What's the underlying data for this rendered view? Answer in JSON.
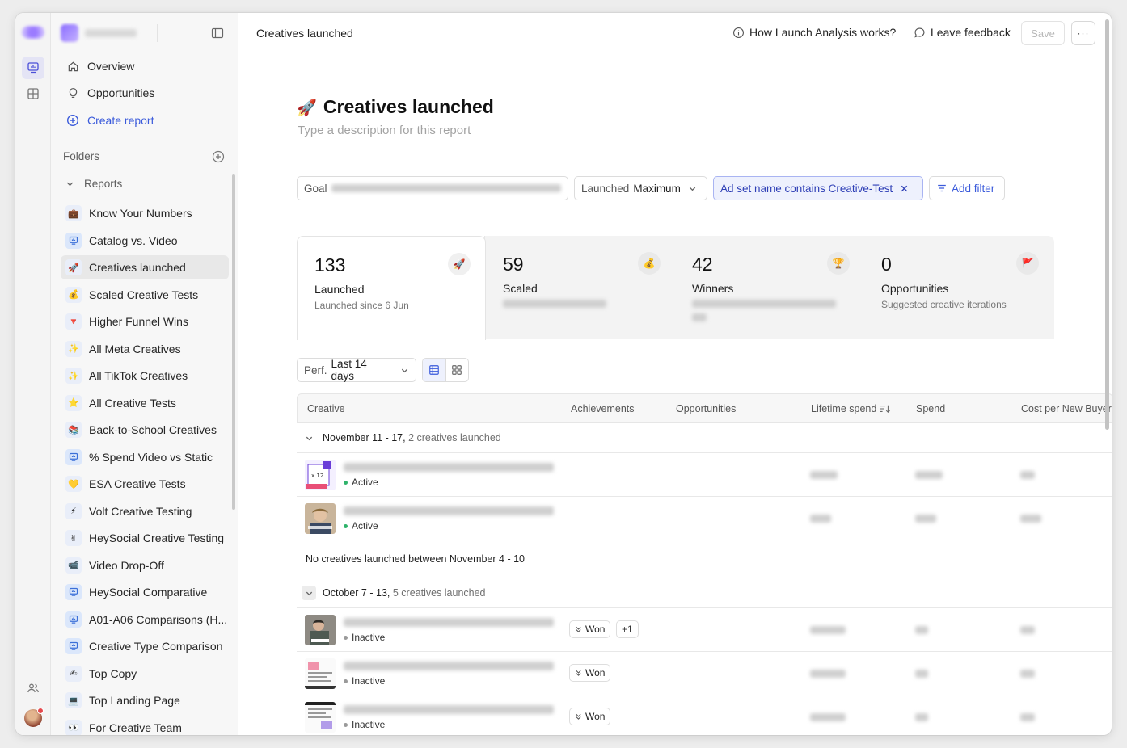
{
  "header": {
    "title": "Creatives launched",
    "how_label": "How Launch Analysis works?",
    "feedback_label": "Leave feedback",
    "save_label": "Save",
    "more_label": "···"
  },
  "sidebar": {
    "nav": [
      {
        "label": "Overview",
        "icon": "home-icon"
      },
      {
        "label": "Opportunities",
        "icon": "lightbulb-icon"
      },
      {
        "label": "Create report",
        "icon": "plus-circle-icon"
      }
    ],
    "folders_label": "Folders",
    "reports_label": "Reports",
    "reports": [
      {
        "label": "Know Your Numbers",
        "emoji": "💼"
      },
      {
        "label": "Catalog vs. Video",
        "emoji": "chart"
      },
      {
        "label": "Creatives launched",
        "emoji": "🚀",
        "active": true
      },
      {
        "label": "Scaled Creative Tests",
        "emoji": "💰"
      },
      {
        "label": "Higher Funnel Wins",
        "emoji": "🔻"
      },
      {
        "label": "All Meta Creatives",
        "emoji": "✨"
      },
      {
        "label": "All TikTok Creatives",
        "emoji": "✨"
      },
      {
        "label": "All Creative Tests",
        "emoji": "⭐"
      },
      {
        "label": "Back-to-School Creatives",
        "emoji": "📚"
      },
      {
        "label": "% Spend Video vs Static",
        "emoji": "chart"
      },
      {
        "label": "ESA Creative Tests",
        "emoji": "💛"
      },
      {
        "label": "Volt Creative Testing",
        "emoji": "⚡"
      },
      {
        "label": "HeySocial Creative Testing",
        "emoji": "✌"
      },
      {
        "label": "Video Drop-Off",
        "emoji": "📹"
      },
      {
        "label": "HeySocial Comparative",
        "emoji": "chart"
      },
      {
        "label": "A01-A06 Comparisons (H...",
        "emoji": "chart"
      },
      {
        "label": "Creative Type Comparison",
        "emoji": "chart"
      },
      {
        "label": "Top Copy",
        "emoji": "✍"
      },
      {
        "label": "Top Landing Page",
        "emoji": "💻"
      },
      {
        "label": "For Creative Team",
        "emoji": "👀"
      }
    ]
  },
  "report": {
    "title": "Creatives launched",
    "title_emoji": "🚀",
    "description_placeholder": "Type a description for this report"
  },
  "filters": {
    "goal_label": "Goal",
    "launched_label": "Launched",
    "launched_value": "Maximum",
    "adset_filter": "Ad set name contains Creative-Test",
    "add_filter": "Add filter"
  },
  "kpis": [
    {
      "value": "133",
      "label": "Launched",
      "sub": "Launched since 6 Jun",
      "emoji": "🚀"
    },
    {
      "value": "59",
      "label": "Scaled",
      "sub": "",
      "emoji": "💰"
    },
    {
      "value": "42",
      "label": "Winners",
      "sub": "",
      "emoji": "🏆"
    },
    {
      "value": "0",
      "label": "Opportunities",
      "sub": "Suggested creative iterations",
      "emoji": "🚩"
    }
  ],
  "perf": {
    "label": "Perf.",
    "value": "Last 14 days"
  },
  "table": {
    "columns": [
      "Creative",
      "Achievements",
      "Opportunities",
      "Lifetime spend",
      "Spend",
      "Cost per New Buyer"
    ],
    "groups": [
      {
        "range": "November 11 - 17,",
        "count": "2 creatives launched"
      },
      {
        "empty": "No creatives launched between November 4 - 10"
      },
      {
        "range": "October 7 - 13,",
        "count": "5 creatives launched"
      }
    ],
    "rows": [
      {
        "status": "Active"
      },
      {
        "status": "Active"
      },
      {
        "status": "Inactive",
        "achievement": "Won",
        "extra": "+1"
      },
      {
        "status": "Inactive",
        "achievement": "Won"
      },
      {
        "status": "Inactive",
        "achievement": "Won"
      }
    ]
  },
  "colors": {
    "accent": "#3b5bdb",
    "active_dot": "#2fb36b",
    "inactive_dot": "#9a9a9a"
  }
}
